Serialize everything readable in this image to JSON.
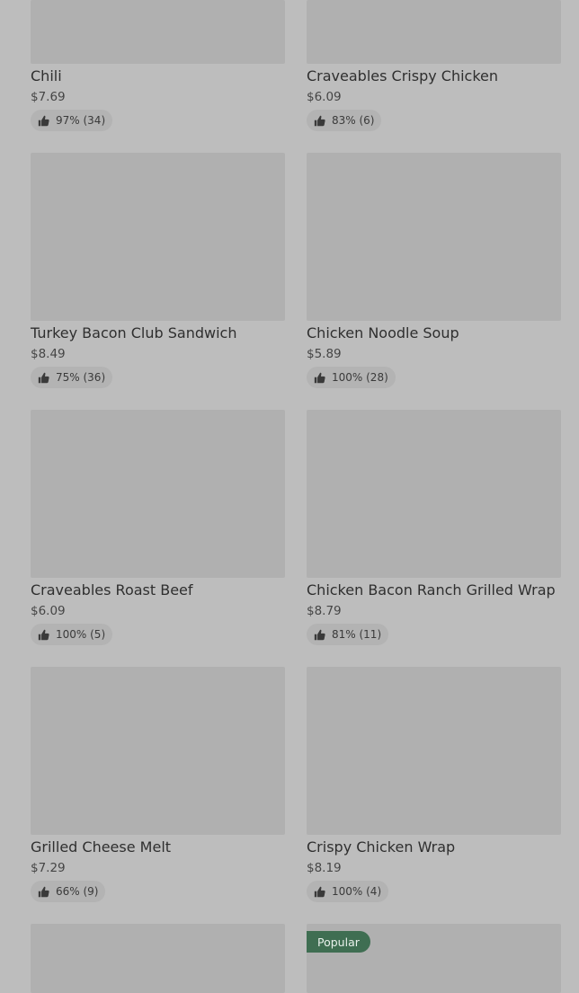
{
  "products": [
    {
      "name": "Chili",
      "price": "$7.69",
      "rating": "97% (34)"
    },
    {
      "name": "Craveables Crispy Chicken",
      "price": "$6.09",
      "rating": "83% (6)"
    },
    {
      "name": "Turkey Bacon Club Sandwich",
      "price": "$8.49",
      "rating": "75% (36)"
    },
    {
      "name": "Chicken Noodle Soup",
      "price": "$5.89",
      "rating": "100% (28)"
    },
    {
      "name": "Craveables Roast Beef",
      "price": "$6.09",
      "rating": "100% (5)"
    },
    {
      "name": "Chicken Bacon Ranch Grilled Wrap",
      "price": "$8.79",
      "rating": "81% (11)"
    },
    {
      "name": "Grilled Cheese Melt",
      "price": "$7.29",
      "rating": "66% (9)"
    },
    {
      "name": "Crispy Chicken Wrap",
      "price": "$8.19",
      "rating": "100% (4)"
    }
  ],
  "badges": {
    "popular": "Popular"
  },
  "icons": {
    "rating": "thumbs-up-icon"
  },
  "colors": {
    "background": "#bdbdbd",
    "image_placeholder": "#b0b0b0",
    "popular_badge": "#3f6e52"
  }
}
